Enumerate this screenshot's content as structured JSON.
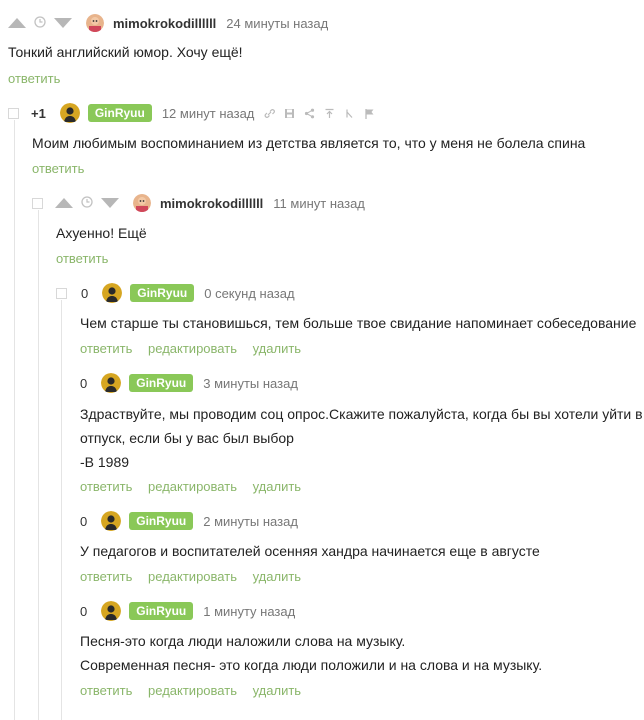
{
  "ui": {
    "reply": "ответить",
    "edit": "редактировать",
    "delete": "удалить",
    "accent_color": "#8ac858",
    "link_color": "#8ab66a"
  },
  "comments": [
    {
      "author": "mimokrokodillllll",
      "time": "24 минуты назад",
      "lines": [
        "Тонкий английский юмор. Хочу ещё!"
      ]
    },
    {
      "rating": "+1",
      "author": "GinRyuu",
      "time": "12 минут назад",
      "lines": [
        "Моим любимым воспоминанием из детства является то, что у меня не болела спина"
      ]
    },
    {
      "author": "mimokrokodillllll",
      "time": "11 минут назад",
      "lines": [
        "Ахуенно! Ещё"
      ]
    },
    {
      "rating": "0",
      "author": "GinRyuu",
      "time": "0 секунд назад",
      "lines": [
        "Чем старше ты становишься, тем больше твое свидание напоминает собеседование"
      ]
    },
    {
      "rating": "0",
      "author": "GinRyuu",
      "time": "3 минуты назад",
      "lines": [
        "Здраствуйте, мы проводим соц опрос.Скажите пожалуйста, когда бы вы хотели уйти в",
        "отпуск, если бы у вас был выбор",
        "-В 1989"
      ]
    },
    {
      "rating": "0",
      "author": "GinRyuu",
      "time": "2 минуты назад",
      "lines": [
        "У педагогов и воспитателей осенняя хандра начинается еще в августе"
      ]
    },
    {
      "rating": "0",
      "author": "GinRyuu",
      "time": "1 минуту назад",
      "lines": [
        "Песня-это когда люди наложили слова на музыку.",
        "Современная песня- это когда люди положили и на слова и на музыку."
      ]
    }
  ]
}
